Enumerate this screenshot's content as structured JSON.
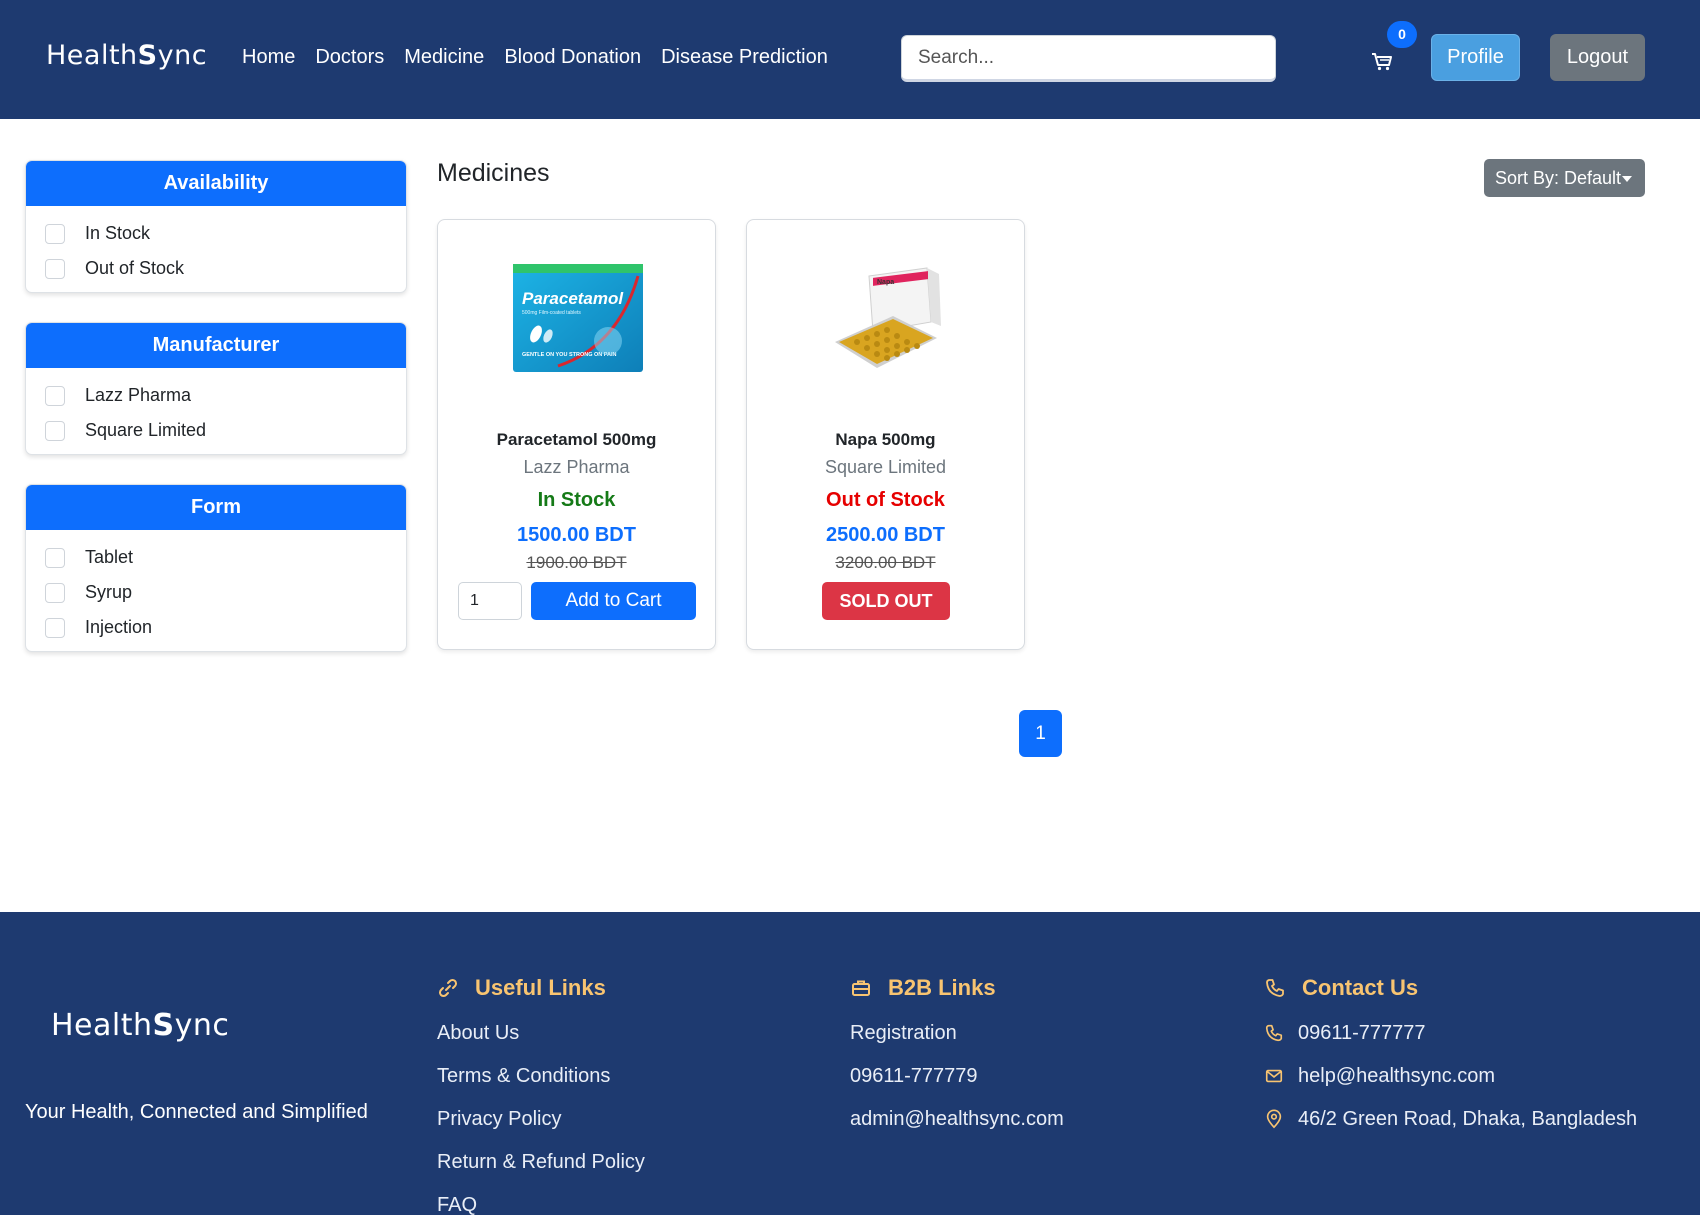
{
  "brand": {
    "logo_prefix": "Health",
    "logo_s": "S",
    "logo_suffix": "ync"
  },
  "nav": {
    "links": [
      "Home",
      "Doctors",
      "Medicine",
      "Blood Donation",
      "Disease Prediction"
    ],
    "search_placeholder": "Search...",
    "cart_count": "0",
    "profile_label": "Profile",
    "logout_label": "Logout"
  },
  "filters": [
    {
      "title": "Availability",
      "options": [
        "In Stock",
        "Out of Stock"
      ]
    },
    {
      "title": "Manufacturer",
      "options": [
        "Lazz Pharma",
        "Square Limited"
      ]
    },
    {
      "title": "Form",
      "options": [
        "Tablet",
        "Syrup",
        "Injection"
      ]
    }
  ],
  "main": {
    "title": "Medicines",
    "sort_label": "Sort By: Default",
    "products": [
      {
        "name": "Paracetamol 500mg",
        "manufacturer": "Lazz Pharma",
        "stock": "In Stock",
        "price": "1500.00 BDT",
        "old_price": "1900.00 BDT",
        "quantity": "1",
        "action": "Add to Cart",
        "box_text": "Paracetamol",
        "box_small": "500mg Film-coated tablets",
        "box_tag": "GENTLE ON YOU STRONG ON PAIN",
        "colors": {
          "box": "#1aa6d8",
          "accent": "#d9272e"
        }
      },
      {
        "name": "Napa 500mg",
        "manufacturer": "Square Limited",
        "stock": "Out of Stock",
        "price": "2500.00 BDT",
        "old_price": "3200.00 BDT",
        "action": "SOLD OUT",
        "box_text": "Napa",
        "colors": {
          "box": "#f4f4f4",
          "accent": "#e0245e",
          "blister": "#d9a520"
        }
      }
    ],
    "page": "1"
  },
  "footer": {
    "tagline": "Your Health, Connected and Simplified",
    "useful": {
      "title": "Useful Links",
      "icon": "link-icon",
      "items": [
        "About Us",
        "Terms & Conditions",
        "Privacy Policy",
        "Return & Refund Policy",
        "FAQ"
      ]
    },
    "b2b": {
      "title": "B2B Links",
      "icon": "briefcase-icon",
      "items": [
        "Registration",
        "09611-777779",
        "admin@healthsync.com"
      ]
    },
    "contact": {
      "title": "Contact Us",
      "icon": "phone-icon",
      "items": [
        {
          "icon": "phone-icon",
          "text": "09611-777777"
        },
        {
          "icon": "mail-icon",
          "text": "help@healthsync.com"
        },
        {
          "icon": "location-pin-icon",
          "text": "46/2 Green Road, Dhaka, Bangladesh"
        }
      ]
    }
  },
  "colors": {
    "navbar": "#1e3a70",
    "primary": "#0d6efd",
    "danger": "#dc3545",
    "success": "#157a17",
    "footer_heading": "#f8c471"
  }
}
